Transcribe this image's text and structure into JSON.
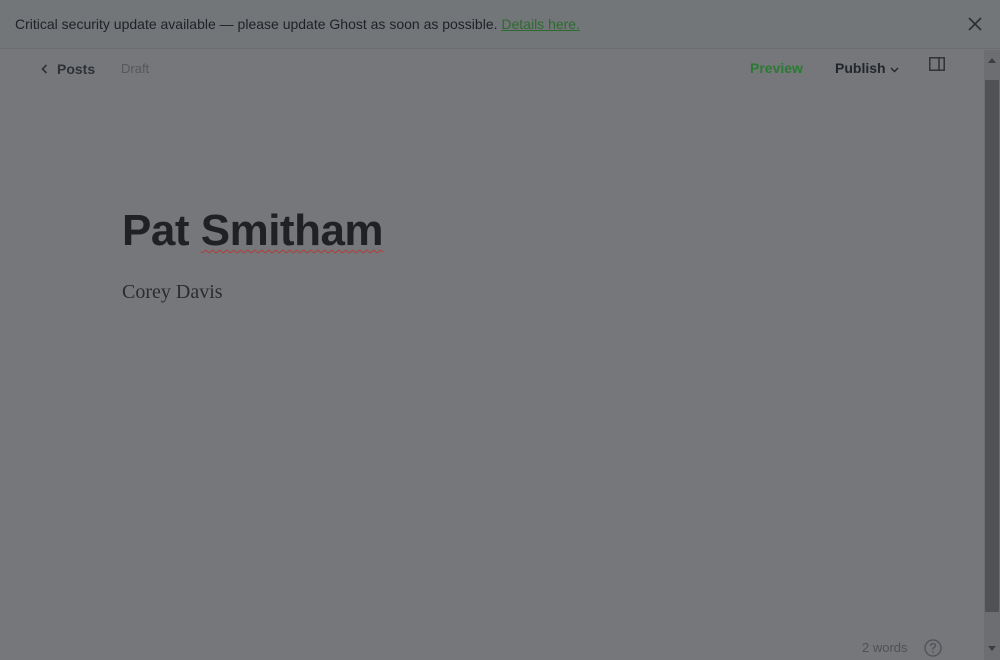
{
  "banner": {
    "message": "Critical security update available — please update Ghost as soon as possible.",
    "link_label": "Details here.",
    "close_icon": "close-icon"
  },
  "header": {
    "back_label": "Posts",
    "back_icon": "chevron-left-icon",
    "status": "Draft",
    "preview_label": "Preview",
    "publish_label": "Publish",
    "publish_icon": "chevron-down-icon",
    "sidebar_icon": "sidebar-toggle-icon"
  },
  "post": {
    "title_first": "Pat",
    "title_second": "Smitham",
    "body": "Corey Davis"
  },
  "footer": {
    "word_count": "2 words",
    "help_icon": "help-circle-icon"
  },
  "colors": {
    "background": "#75777a",
    "accent_green": "#2b7a34",
    "text_dark": "#1f2125"
  }
}
